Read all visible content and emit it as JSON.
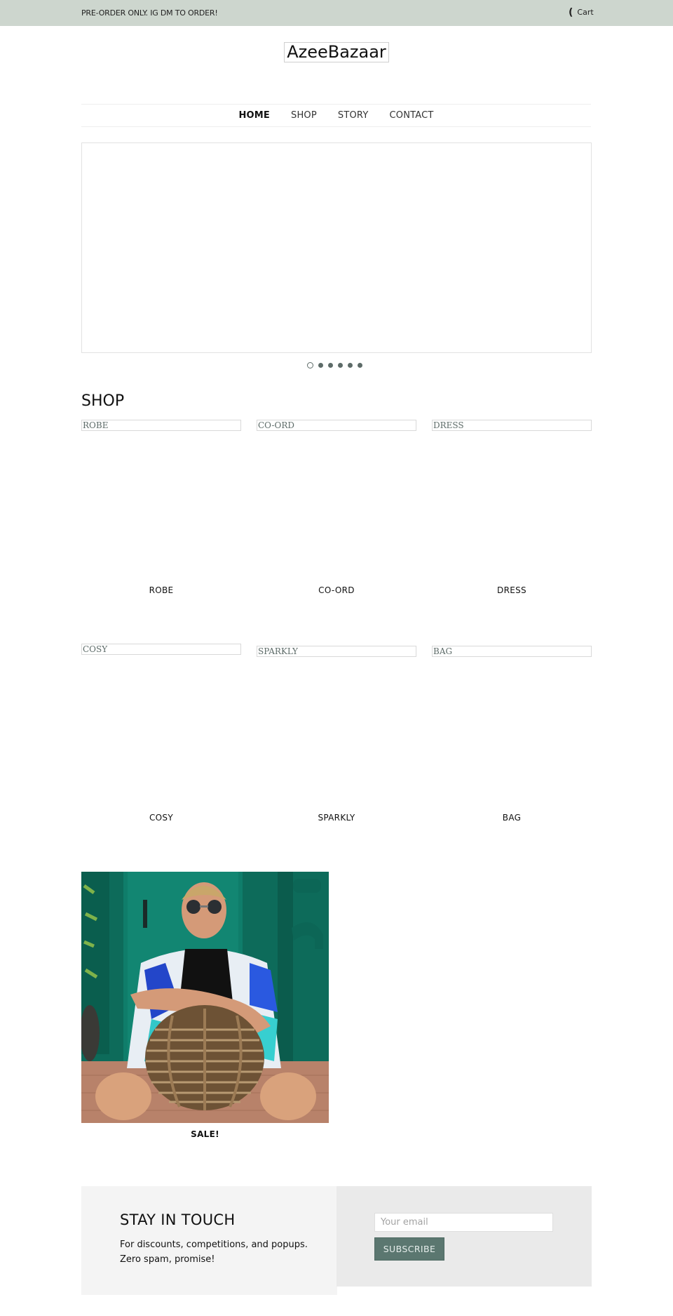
{
  "topbar": {
    "announcement": "PRE-ORDER ONLY. IG DM TO ORDER!",
    "cart_icon": "bag-icon",
    "cart_glyph": "(",
    "cart_label": "Cart"
  },
  "header": {
    "logo_text": "AzeeBazaar"
  },
  "nav": {
    "items": [
      {
        "label": "HOME",
        "active": true
      },
      {
        "label": "SHOP",
        "active": false
      },
      {
        "label": "STORY",
        "active": false
      },
      {
        "label": "CONTACT",
        "active": false
      }
    ]
  },
  "slideshow": {
    "slide_count": 6,
    "active_index": 0
  },
  "shop": {
    "heading": "SHOP",
    "collections": [
      {
        "alt": "ROBE",
        "label": "ROBE"
      },
      {
        "alt": "CO-ORD",
        "label": "CO-ORD"
      },
      {
        "alt": "DRESS",
        "label": "DRESS"
      },
      {
        "alt": "COSY",
        "label": "COSY"
      },
      {
        "alt": "SPARKLY",
        "label": "SPARKLY"
      },
      {
        "alt": "BAG",
        "label": "BAG"
      }
    ]
  },
  "sale": {
    "label": "SALE!",
    "image_description": "Man in sunglasses and blue patterned robe sitting backwards on a rattan chair in front of a green door"
  },
  "newsletter": {
    "heading": "STAY IN TOUCH",
    "text": "For discounts, competitions, and popups. Zero spam, promise!",
    "email_placeholder": "Your email",
    "email_value": "",
    "subscribe_label": "SUBSCRIBE"
  },
  "colors": {
    "topbar_bg": "#cdd6ce",
    "accent": "#5b7770",
    "newsletter_left_bg": "#f4f4f4",
    "newsletter_right_bg": "#eaeaea"
  }
}
